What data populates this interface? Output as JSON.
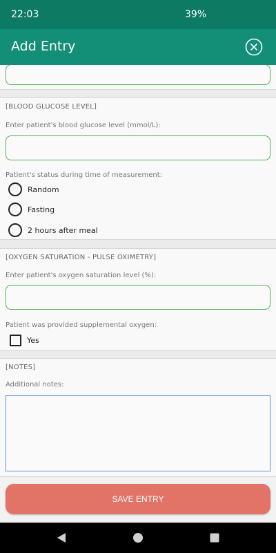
{
  "status_bar": {
    "time": "22:03",
    "battery": "39%"
  },
  "app_bar": {
    "title": "Add Entry",
    "close_icon": "close-circle-icon"
  },
  "blood_glucose": {
    "header": "[BLOOD GLUCOSE LEVEL]",
    "prompt": "Enter patient's blood glucose level (mmol/L):",
    "value": "",
    "status_prompt": "Patient's status during time of measurement:",
    "options": [
      "Random",
      "Fasting",
      "2 hours after meal"
    ]
  },
  "oxygen": {
    "header": "[OXYGEN SATURATION - PULSE OXIMETRY]",
    "prompt": "Enter patient's oxygen saturation level (%):",
    "value": "",
    "supplemental_prompt": "Patient was provided supplemental oxygen:",
    "checkbox_label": "Yes",
    "checked": false
  },
  "notes": {
    "header": "[NOTES]",
    "prompt": "Additional notes:",
    "value": ""
  },
  "footer": {
    "save_label": "SAVE ENTRY"
  },
  "colors": {
    "status_bar": "#0d7a64",
    "app_bar": "#138f78",
    "field_border": "#4caf50",
    "notes_border": "#5b8ed6",
    "save_button": "#e27367"
  },
  "nav": {
    "back_icon": "back-triangle-icon",
    "home_icon": "home-circle-icon",
    "recents_icon": "recents-square-icon"
  }
}
